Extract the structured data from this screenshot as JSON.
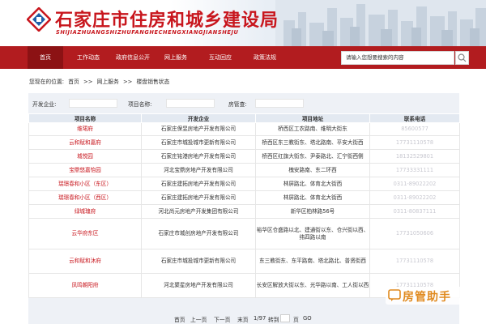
{
  "header": {
    "title": "石家庄市住房和城乡建设局",
    "pinyin": "SHIJIAZHUANGSHIZHUFANGHECHENGXIANGJIANSHEJU"
  },
  "nav": {
    "items": [
      {
        "label": "首页"
      },
      {
        "label": "工作动态"
      },
      {
        "label": "政府信息公开"
      },
      {
        "label": "网上服务"
      },
      {
        "label": "互动回应"
      },
      {
        "label": "政策法规"
      }
    ],
    "search_placeholder": "请输入您想要搜索的内容"
  },
  "breadcrumb": {
    "prefix": "您现在的位置:",
    "items": [
      "首页",
      ">>",
      "网上服务",
      ">>",
      "楼盘销售状态"
    ]
  },
  "filters": {
    "developer_label": "开发企业:",
    "project_label": "项目名称:",
    "manager_label": "房管查:"
  },
  "table": {
    "headers": [
      "项目名称",
      "开发企业",
      "项目地址",
      "联系电话"
    ],
    "rows": [
      {
        "name": "维珺府",
        "developer": "石家庄保昱房地产开发有限公司",
        "address": "桥西区工农路南、维明大街东",
        "phone": "85600577"
      },
      {
        "name": "云和赋和嘉府",
        "developer": "石家庄市城投城市更新有限公司",
        "address": "桥西区东三教街东、塔北路南、平安大街西",
        "phone": "17731110578"
      },
      {
        "name": "城悦园",
        "developer": "石家庄铭港房地产开发有限公司",
        "address": "桥西区红旗大街东、尹泰路北、汇宁街西侧",
        "phone": "18132529801"
      },
      {
        "name": "宝鼎悠嘉怡园",
        "developer": "河北宝鼎房地产开发有限公司",
        "address": "槐安路南、东二环西",
        "phone": "17733331111"
      },
      {
        "name": "瑞璟春和小区（东区）",
        "developer": "石家庄建拓房地产开发有限公司",
        "address": "林屏路北、体育北大街西",
        "phone": "0311-89022202"
      },
      {
        "name": "瑞璟春和小区（西区）",
        "developer": "石家庄建拓房地产开发有限公司",
        "address": "林屏路北、体育北大街西",
        "phone": "0311-89022202"
      },
      {
        "name": "绿城瑰府",
        "developer": "河北尚元房地产开发集团有限公司",
        "address": "新华区柏林路56号",
        "phone": "0311-80837111"
      },
      {
        "name": "云华府东区",
        "developer": "石家庄市城创房地产开发有限公司",
        "address": "裕华区仓盛路以北、建通街以东、仓兴街以西、纬四路以南",
        "phone": "17731050606"
      },
      {
        "name": "云和赋和沐府",
        "developer": "石家庄市城投城市更新有限公司",
        "address": "东三教街东、东平路南、塔北路北、普贤街西",
        "phone": "17731110578"
      },
      {
        "name": "凤鸣朝阳府",
        "developer": "河北聚星房地产开发有限公司",
        "address": "长安区解放大街以东、光华路以南、工人街以西",
        "phone": "17731110578"
      }
    ]
  },
  "pager": {
    "first": "首页",
    "prev": "上一页",
    "next": "下一页",
    "last": "末页",
    "page_info": "1/97",
    "goto": "转到",
    "page_unit": "页",
    "go": "GO"
  },
  "watermark": {
    "text": "房管助手"
  },
  "colors": {
    "brand_red": "#c8161d",
    "nav_red": "#b21c1f",
    "panel_bg": "#eef1f6"
  }
}
